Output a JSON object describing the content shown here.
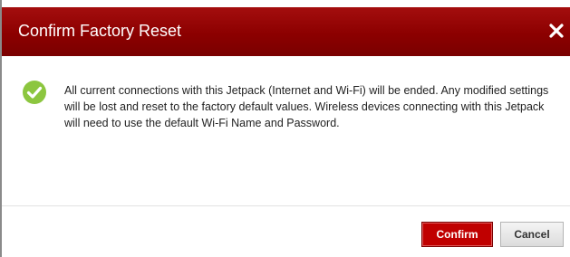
{
  "dialog": {
    "title": "Confirm Factory Reset",
    "close_icon": "close-icon",
    "status_icon": "check-circle-icon",
    "message": "All current connections with this Jetpack (Internet and Wi-Fi) will be ended. Any modified settings will be lost and reset to the factory default values. Wireless devices connecting with this Jetpack will need to use the default Wi-Fi Name and Password.",
    "buttons": {
      "confirm_label": "Confirm",
      "cancel_label": "Cancel"
    }
  },
  "colors": {
    "titlebar": "#8c0000",
    "confirm_button": "#c00000",
    "check_icon": "#8cc63f"
  }
}
